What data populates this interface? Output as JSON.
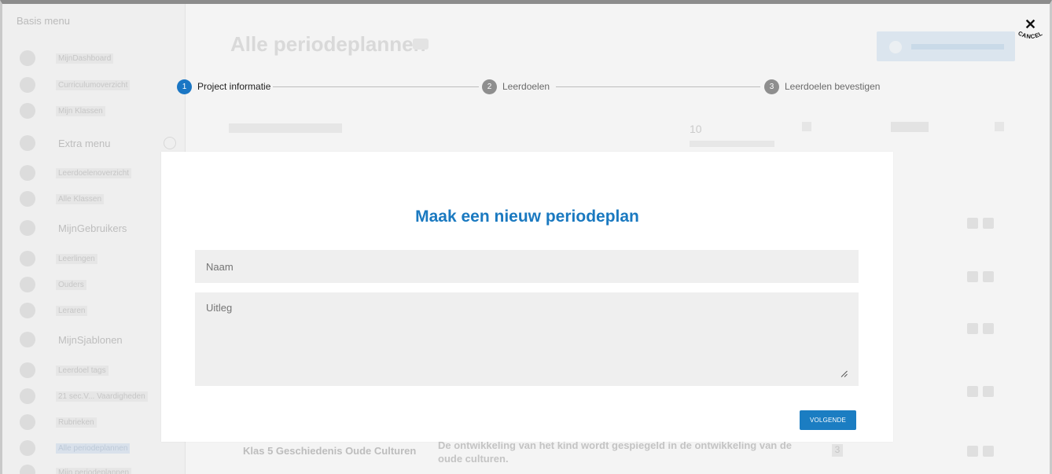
{
  "sidebar": {
    "basis_title": "Basis menu",
    "items": [
      {
        "label": "MijnDashboard",
        "icon": "home-icon"
      },
      {
        "label": "Curriculumoverzicht",
        "icon": "curriculum-icon"
      },
      {
        "label": "Mijn Klassen",
        "icon": "users-icon"
      }
    ],
    "extra_title": "Extra menu",
    "extra_items": [
      {
        "label": "Leerdoelenoverzicht",
        "icon": "folder-icon"
      },
      {
        "label": "Alle Klassen",
        "icon": "users-icon"
      }
    ],
    "users_section": "MijnGebruikers",
    "user_items": [
      {
        "label": "Leerlingen",
        "icon": "student-icon"
      },
      {
        "label": "Ouders",
        "icon": "parent-icon"
      },
      {
        "label": "Leraren",
        "icon": "teacher-icon"
      }
    ],
    "templates_section": "MijnSjablonen",
    "template_items": [
      {
        "label": "Leerdoel tags",
        "icon": "tag-icon"
      },
      {
        "label": "21 sec.V... Vaardigheden",
        "icon": "skills-icon"
      },
      {
        "label": "Rubrieken",
        "icon": "rubric-icon"
      },
      {
        "label": "Alle periodeplannen",
        "icon": "plans-icon"
      },
      {
        "label": "Mijn periodeplannen",
        "icon": "plans-icon"
      }
    ]
  },
  "main": {
    "title": "Alle periodeplannen",
    "rows_per_page": "10",
    "last_row": {
      "title": "Klas 5 Geschiedenis Oude Culturen",
      "description": "De ontwikkeling van het kind wordt gespiegeld in de ontwikkeling van de oude culturen.",
      "count": "3"
    }
  },
  "stepper": {
    "steps": [
      {
        "number": "1",
        "label": "Project informatie",
        "state": "active"
      },
      {
        "number": "2",
        "label": "Leerdoelen",
        "state": "inactive"
      },
      {
        "number": "3",
        "label": "Leerdoelen bevestigen",
        "state": "inactive"
      }
    ]
  },
  "modal": {
    "title": "Maak een nieuw periodeplan",
    "name_placeholder": "Naam",
    "name_value": "",
    "description_placeholder": "Uitleg",
    "description_value": "",
    "next_label": "VOLGENDE"
  },
  "cancel": {
    "label": "CANCEL",
    "icon": "close-icon",
    "glyph": "✕"
  },
  "colors": {
    "accent": "#1a79c0",
    "active_step": "#1a76c4",
    "inactive_step": "#8e8e8e",
    "field_bg": "#efefef"
  }
}
